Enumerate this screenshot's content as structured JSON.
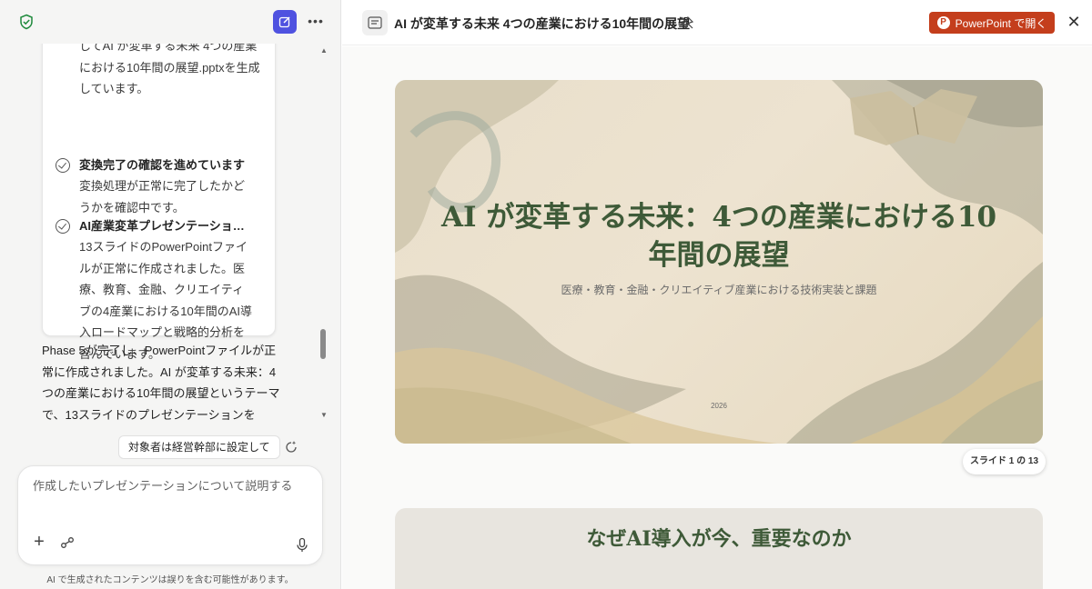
{
  "left_panel": {
    "card": {
      "top_text": "してAI が変革する未来 4つの産業における10年間の展望.pptxを生成しています。",
      "steps": [
        {
          "title": "変換完了の確認を進めています",
          "body": "変換処理が正常に完了したかどうかを確認中です。"
        },
        {
          "title": "AI産業変革プレゼンテーショ…",
          "body": "13スライドのPowerPointファイルが正常に作成されました。医療、教育、金融、クリエイティブの4産業における10年間のAI導入ロードマップと戦略的分析を含んでいます。"
        }
      ]
    },
    "message": "Phase 5が完了し、PowerPointファイルが正常に作成されました。AI が変革する未来：4つの産業における10年間の展望というテーマで、13スライドのプレゼンテーションを",
    "suggestion": "対象者は経営幹部に設定して",
    "input_placeholder": "作成したいプレゼンテーションについて説明する",
    "disclaimer": "AI で生成されたコンテンツは誤りを含む可能性があります。"
  },
  "right_panel": {
    "doc_title": "AI が変革する未来 4つの産業における10年間の展望",
    "open_button": "PowerPoint で開く",
    "slide1": {
      "title": "AI が変革する未来：4つの産業における10年間の展望",
      "subtitle": "医療・教育・金融・クリエイティブ産業における技術実装と課題",
      "year": "2026"
    },
    "slide_counter": "スライド 1 の 13",
    "slide2": {
      "title": "なぜAI導入が今、重要なのか"
    }
  },
  "colors": {
    "accent": "#4f52e0",
    "ppt_red": "#c43e1c",
    "slide_title_green": "#3e5a38"
  }
}
